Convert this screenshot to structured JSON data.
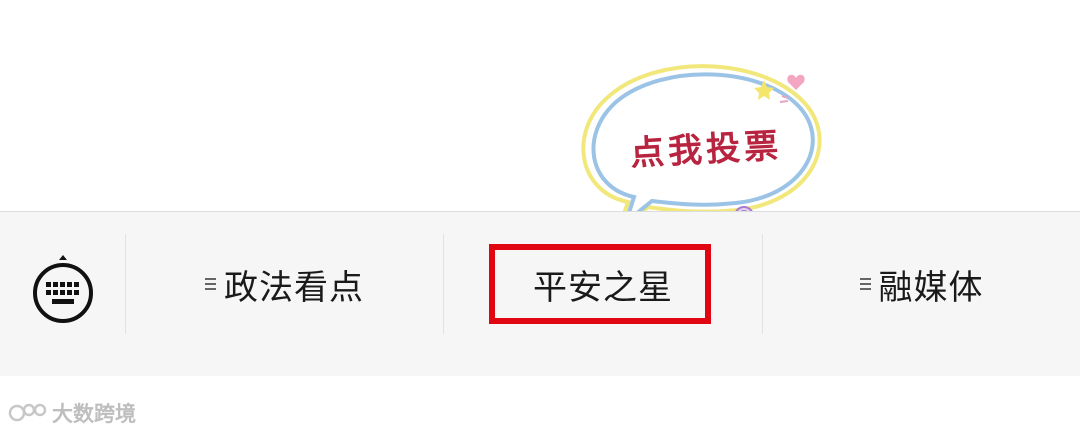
{
  "bubble": {
    "text": "点我投票"
  },
  "menubar": {
    "keyboard_icon": "keyboard-icon",
    "items": [
      {
        "label": "政法看点",
        "has_submenu": true
      },
      {
        "label": "平安之星",
        "has_submenu": false
      },
      {
        "label": "融媒体",
        "has_submenu": true
      }
    ],
    "highlight_color": "#e00612"
  },
  "watermark": {
    "text": "大数跨境",
    "icon": "dashuju-logo-icon"
  }
}
